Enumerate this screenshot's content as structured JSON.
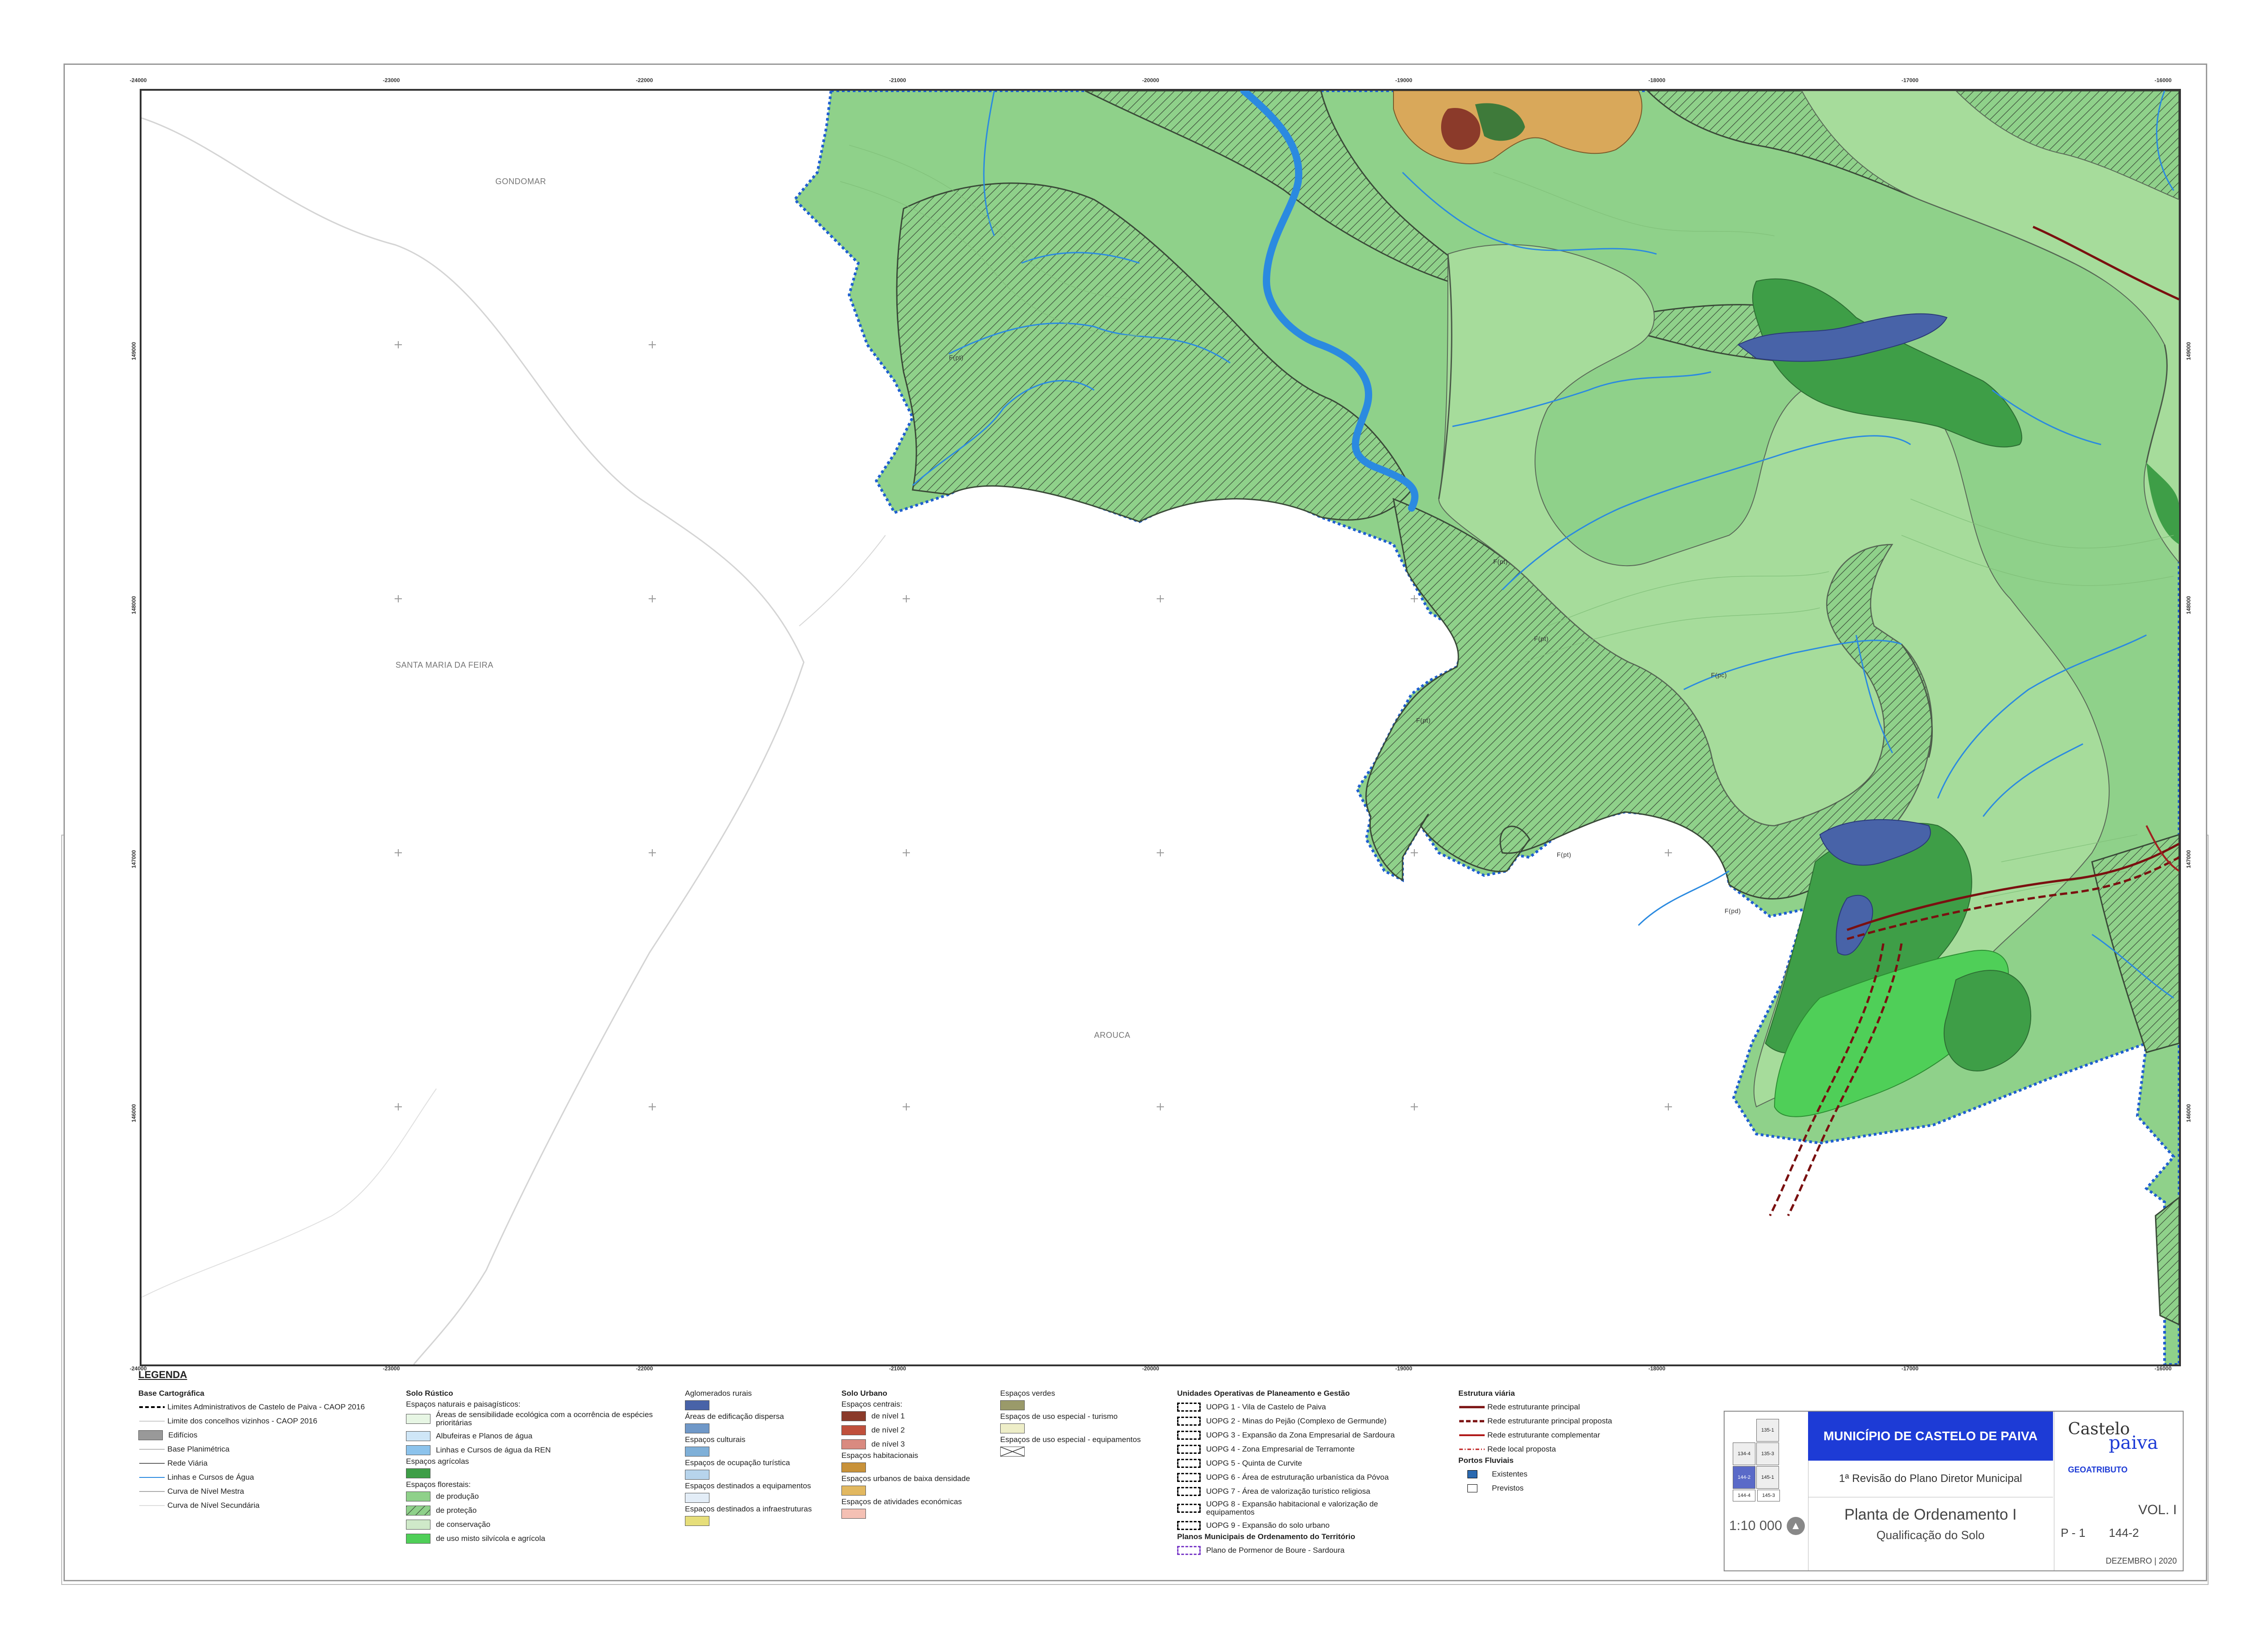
{
  "map": {
    "coords_top": [
      "-24000",
      "-23000",
      "-22000",
      "-21000",
      "-20000",
      "-19000",
      "-18000",
      "-17000",
      "-16000"
    ],
    "coords_side": [
      "149000",
      "148000",
      "147000",
      "146000"
    ],
    "places": {
      "gondomar": "GONDOMAR",
      "santa_maria_da_feira": "SANTA MARIA DA FEIRA",
      "arouca": "AROUCA"
    },
    "zone_labels": {
      "fpt": "F(pt)",
      "fpc": "F(pc)",
      "fpd": "F(pd)"
    },
    "colors": {
      "green_production": "#8fd18a",
      "green_light": "#a6dc9b",
      "green_dark": "#3e9e47",
      "green_bright": "#4fcf58",
      "rural_blue": "#4863a8",
      "river": "#2b8ae0",
      "road_principal": "#7a1010"
    }
  },
  "legend": {
    "title": "LEGENDA",
    "base": {
      "title": "Base Cartográfica",
      "items": [
        "Limites Administrativos de Castelo de Paiva - CAOP 2016",
        "Limite dos concelhos vizinhos  - CAOP 2016",
        "Edifícios",
        "Base Planimétrica",
        "Rede Viária",
        "Linhas e Cursos de Água",
        "Curva de Nível Mestra",
        "Curva de Nível Secundária"
      ]
    },
    "rustico": {
      "title": "Solo Rústico",
      "subtitle": "Espaços naturais e paisagísticos:",
      "natural": [
        "Áreas de sensibilidade ecológica com a ocorrência de espécies prioritárias",
        "Albufeiras e Planos de água",
        "Linhas e Cursos de água da REN"
      ],
      "agricolas": "Espaços agrícolas",
      "florestais": "Espaços florestais:",
      "florestal_items": [
        "de produção",
        "de proteção",
        "de conservação",
        "de uso misto silvícola e agrícola"
      ]
    },
    "aglomerados": {
      "items": [
        "Aglomerados rurais",
        "Áreas de edificação dispersa",
        "Espaços culturais",
        "Espaços de ocupação turística",
        "Espaços destinados a equipamentos",
        "Espaços destinados a infraestruturas"
      ]
    },
    "urbano": {
      "title": "Solo Urbano",
      "centrais": "Espaços centrais:",
      "niveis": [
        "de nível 1",
        "de nível 2",
        "de nível 3"
      ],
      "others": [
        "Espaços habitacionais",
        "Espaços urbanos de baixa densidade",
        "Espaços de atividades económicas"
      ]
    },
    "verdes": {
      "items": [
        "Espaços verdes",
        "Espaços de uso especial - turismo",
        "Espaços de uso especial - equipamentos"
      ]
    },
    "uopg": {
      "title": "Unidades Operativas de Planeamento e Gestão",
      "items": [
        "UOPG 1 - Vila de Castelo de Paiva",
        "UOPG 2 - Minas do Pejão (Complexo de Germunde)",
        "UOPG 3 - Expansão da Zona Empresarial de Sardoura",
        "UOPG 4 - Zona Empresarial de Terramonte",
        "UOPG 5 - Quinta de Curvite",
        "UOPG 6 - Área de estruturação urbanística da Póvoa",
        "UOPG 7 - Área de valorização turístico religiosa",
        "UOPG 8 - Expansão habitacional e valorização de equipamentos",
        "UOPG 9 - Expansão do solo urbano"
      ],
      "pmot_title": "Planos Municipais de Ordenamento do Território",
      "pmot": "Plano de Pormenor de Boure - Sardoura"
    },
    "viaria": {
      "title": "Estrutura viária",
      "items": [
        "Rede estruturante principal",
        "Rede estruturante principal proposta",
        "Rede estruturante complementar",
        "Rede local proposta"
      ],
      "portos_title": "Portos Fluviais",
      "portos": [
        "Existentes",
        "Previstos"
      ]
    }
  },
  "titleblock": {
    "municipio": "MUNICÍPIO DE CASTELO DE PAIVA",
    "revisao": "1ª Revisão do Plano Diretor Municipal",
    "planta": "Planta de Ordenamento I",
    "qualificacao": "Qualificação do Solo",
    "scale": "1:10 000",
    "vol": "VOL. I",
    "desenho": "P - 1",
    "folha": "144-2",
    "data": "DEZEMBRO | 2020",
    "logo_castelo": "Castelo",
    "logo_paiva": "paiva",
    "logo_geo": "GEOATRIBUTO",
    "index_cells": [
      "135-1",
      "134-4",
      "135-3",
      "144-2",
      "145-1",
      "144-4",
      "145-3"
    ]
  }
}
